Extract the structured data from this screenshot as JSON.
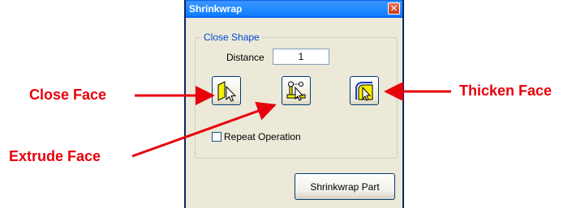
{
  "dialog": {
    "title": "Shrinkwrap",
    "close_glyph": "✕",
    "group": {
      "legend": "Close Shape",
      "distance_label": "Distance",
      "distance_value": "1"
    },
    "tools": [
      {
        "name": "close-face-button",
        "icon": "close-face-icon"
      },
      {
        "name": "extrude-face-button",
        "icon": "extrude-face-icon"
      },
      {
        "name": "thicken-face-button",
        "icon": "thicken-face-icon"
      }
    ],
    "repeat_label": "Repeat Operation",
    "repeat_checked": false,
    "action_label": "Shrinkwrap Part"
  },
  "callouts": {
    "close_face": "Close Face",
    "extrude_face": "Extrude Face",
    "thicken_face": "Thicken Face"
  },
  "colors": {
    "annotation_red": "#e8000b",
    "icon_yellow": "#f5f000",
    "title_blue": "#0058e6"
  }
}
